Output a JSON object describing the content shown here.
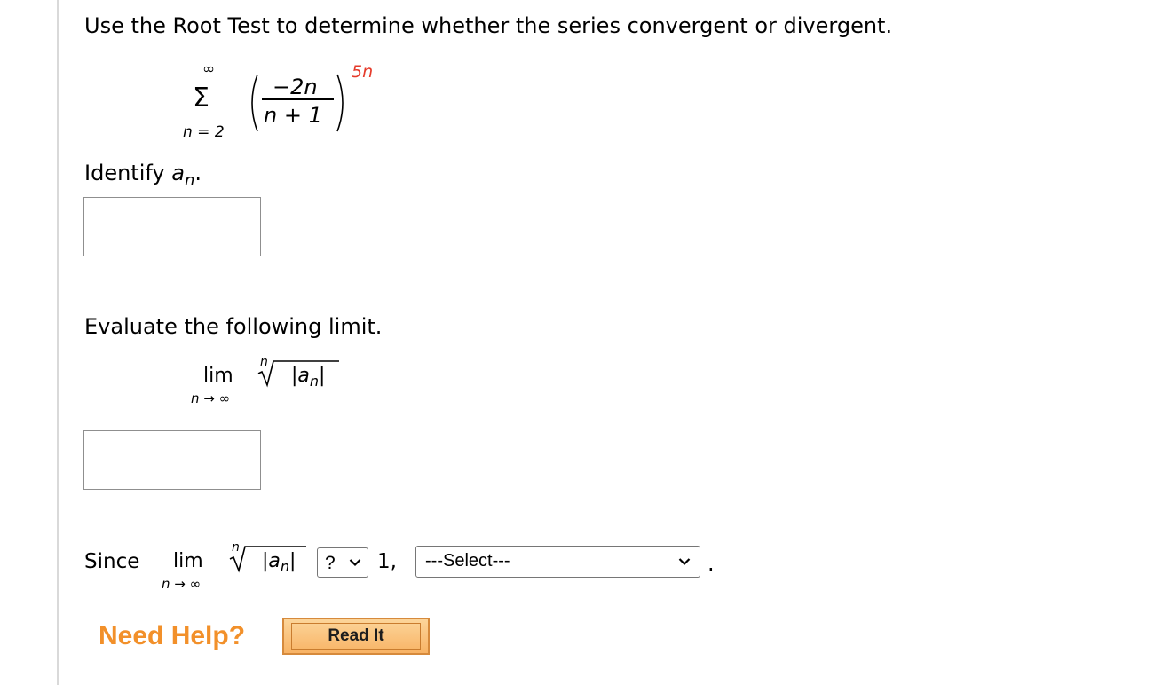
{
  "question": {
    "prompt": "Use the Root Test to determine whether the series convergent or divergent.",
    "series": {
      "sum_symbol": "Σ",
      "upper_limit": "∞",
      "lower_limit": "n = 2",
      "numerator": "−2n",
      "denominator": "n + 1",
      "exponent": "5n"
    }
  },
  "part1": {
    "label": "Identify",
    "term_symbol": "a",
    "term_subscript": "n",
    "term_suffix": ".",
    "answer_value": ""
  },
  "part2": {
    "label": "Evaluate the following limit.",
    "lim_word": "lim",
    "lim_sub": "n → ∞",
    "root_index": "n",
    "root_content": "|a",
    "root_sub": "n",
    "root_bar": "|",
    "answer_value": ""
  },
  "part3": {
    "since": "Since",
    "compare_select": "?",
    "compare_to": "1,",
    "conclusion_select": "---Select---",
    "period": "."
  },
  "help": {
    "label": "Need Help?",
    "read_button": "Read It"
  }
}
